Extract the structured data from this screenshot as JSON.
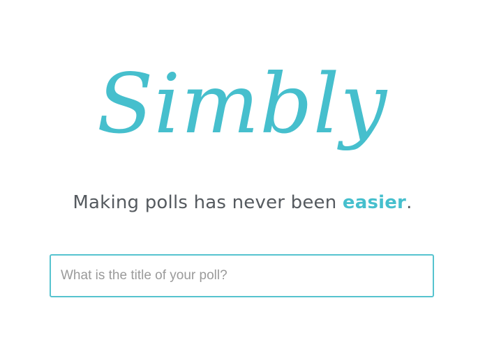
{
  "brand": {
    "logo_text": "Simbly",
    "accent_color": "#46bfcd"
  },
  "tagline": {
    "prefix": "Making polls has never been ",
    "highlight": "easier",
    "suffix": "."
  },
  "poll_form": {
    "title_input": {
      "value": "",
      "placeholder": "What is the title of your poll?"
    }
  }
}
